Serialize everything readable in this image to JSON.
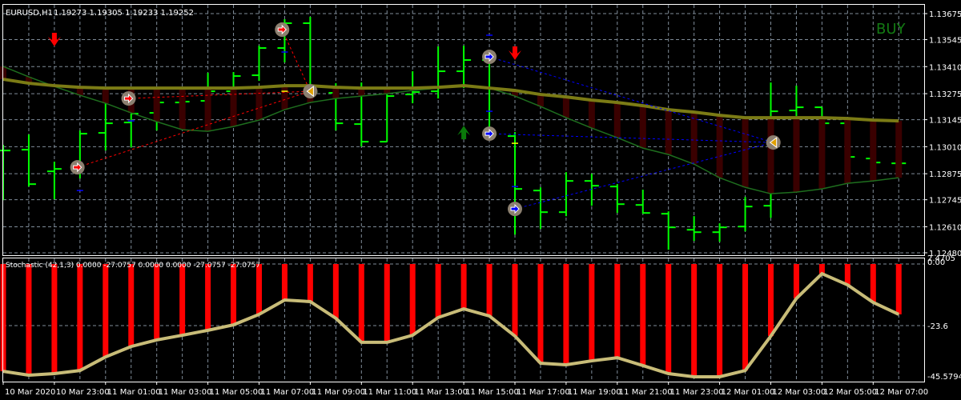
{
  "header": {
    "symbol": "EURUSD,H1",
    "ohlc": "1.19273 1.19305 1.19233 1.19252"
  },
  "signal_label": "BUY",
  "price_axis": [
    "1.13675",
    "1.13545",
    "1.13410",
    "1.13275",
    "1.13145",
    "1.13010",
    "1.12875",
    "1.12745",
    "1.12610",
    "1.12480"
  ],
  "price_axis_values": [
    1.13675,
    1.13545,
    1.1341,
    1.13275,
    1.13145,
    1.1301,
    1.12875,
    1.12745,
    1.1261,
    1.1248
  ],
  "stochastic": {
    "label": "Stochastic (42,1,3) 0.0000 -27.0757 0.0000 0.0000 -27.0757 -27.0757",
    "axis": [
      "2.4705",
      "0.00",
      "-23.6",
      "-45.5794"
    ],
    "values": [
      -41.1,
      -42.6,
      -42.0,
      -40.8,
      -35.6,
      -31.6,
      -29.1,
      -27.3,
      -25.4,
      -23.3,
      -19.3,
      -13.8,
      -14.4,
      -20.8,
      -30.0,
      -30.0,
      -27.3,
      -20.5,
      -17.2,
      -19.9,
      -27.6,
      -38.0,
      -38.6,
      -37.1,
      -35.9,
      -38.9,
      -42.0,
      -43.2,
      -43.2,
      -40.8,
      -27.6,
      -13.2,
      -3.7,
      -8.0,
      -14.7,
      -19.3
    ]
  },
  "time_axis": [
    "10 Mar 2020",
    "10 Mar 23:00",
    "11 Mar 01:00",
    "11 Mar 03:00",
    "11 Mar 05:00",
    "11 Mar 07:00",
    "11 Mar 09:00",
    "11 Mar 11:00",
    "11 Mar 13:00",
    "11 Mar 15:00",
    "11 Mar 17:00",
    "11 Mar 19:00",
    "11 Mar 21:00",
    "11 Mar 23:00",
    "12 Mar 01:00",
    "12 Mar 03:00",
    "12 Mar 05:00",
    "12 Mar 07:00"
  ],
  "colors": {
    "bars": "#00ff00",
    "ma": "#7b7b15",
    "lower": "#1e6e1e",
    "histogram": "#3a0000",
    "stoch_bars": "#ff0000",
    "stoch_line": "#c8bc78",
    "grid": "#7f8c99",
    "buy": "#137a13"
  },
  "chart_data": {
    "type": "ohlc",
    "ohlc": [
      [
        1.12991,
        1.13019,
        1.12743,
        1.12991
      ],
      [
        1.12995,
        1.13071,
        1.12811,
        1.12823
      ],
      [
        1.12887,
        1.12935,
        1.12747,
        1.12899
      ],
      [
        1.12903,
        1.13091,
        1.12851,
        1.13075
      ],
      [
        1.13079,
        1.13227,
        1.12991,
        1.13127
      ],
      [
        1.13131,
        1.13175,
        1.13007,
        1.13175
      ],
      [
        1.13179,
        1.13231,
        1.13091,
        1.13231
      ],
      [
        1.13231,
        1.13239,
        1.13223,
        1.13235
      ],
      [
        1.13239,
        1.13379,
        1.13235,
        1.13287
      ],
      [
        1.13287,
        1.13383,
        1.13279,
        1.13363
      ],
      [
        1.13367,
        1.13515,
        1.13339,
        1.13503
      ],
      [
        1.13503,
        1.13647,
        1.13431,
        1.13627
      ],
      [
        1.13627,
        1.13659,
        1.13263,
        1.13283
      ],
      [
        1.13279,
        1.13327,
        1.13091,
        1.13127
      ],
      [
        1.13123,
        1.13331,
        1.13011,
        1.13035
      ],
      [
        1.13035,
        1.13271,
        1.13035,
        1.13263
      ],
      [
        1.13271,
        1.13387,
        1.13227,
        1.13283
      ],
      [
        1.13287,
        1.13511,
        1.13251,
        1.13387
      ],
      [
        1.13387,
        1.13515,
        1.13303,
        1.13443
      ],
      [
        1.13443,
        1.13483,
        1.13071,
        1.13071
      ],
      [
        1.13063,
        1.13083,
        1.12571,
        1.12799
      ],
      [
        1.12791,
        1.12807,
        1.12599,
        1.12683
      ],
      [
        1.12683,
        1.12883,
        1.12663,
        1.12839
      ],
      [
        1.12839,
        1.12875,
        1.12715,
        1.12815
      ],
      [
        1.12811,
        1.12823,
        1.12679,
        1.12723
      ],
      [
        1.12719,
        1.12795,
        1.12675,
        1.12679
      ],
      [
        1.12675,
        1.12687,
        1.12495,
        1.12607
      ],
      [
        1.12595,
        1.12663,
        1.12539,
        1.12583
      ],
      [
        1.12583,
        1.12627,
        1.12535,
        1.12607
      ],
      [
        1.12611,
        1.12759,
        1.12587,
        1.12711
      ],
      [
        1.12715,
        1.13331,
        1.12655,
        1.13187
      ],
      [
        1.13191,
        1.13315,
        1.13163,
        1.13207
      ],
      [
        1.13207,
        1.13207,
        1.13127,
        1.13127
      ],
      [
        1.13127,
        1.13143,
        1.12955,
        1.12959
      ],
      [
        1.12951,
        1.12959,
        1.12923,
        1.12931
      ],
      [
        1.12927,
        1.12943,
        1.12919,
        1.12927
      ]
    ],
    "ma": [
      1.13347,
      1.13327,
      1.13315,
      1.13307,
      1.13303,
      1.13303,
      1.13303,
      1.13303,
      1.13303,
      1.13303,
      1.13307,
      1.13315,
      1.13315,
      1.13307,
      1.13303,
      1.13303,
      1.13303,
      1.13307,
      1.13315,
      1.13303,
      1.13291,
      1.13271,
      1.13259,
      1.13243,
      1.13231,
      1.13215,
      1.13195,
      1.13183,
      1.13167,
      1.13155,
      1.13155,
      1.13155,
      1.13155,
      1.13151,
      1.13143,
      1.13139
    ],
    "lower": [
      1.13411,
      1.13359,
      1.13311,
      1.13267,
      1.13227,
      1.13179,
      1.13135,
      1.13095,
      1.13087,
      1.13111,
      1.13143,
      1.13195,
      1.13231,
      1.13251,
      1.13263,
      1.13275,
      1.13291,
      1.13303,
      1.13315,
      1.13303,
      1.13263,
      1.13211,
      1.13155,
      1.13103,
      1.13055,
      1.13003,
      1.12971,
      1.12923,
      1.12855,
      1.12807,
      1.12775,
      1.12783,
      1.12799,
      1.12827,
      1.12839,
      1.12855
    ],
    "signals": [
      {
        "bar": 2.9,
        "price": 1.12907,
        "dir": "right",
        "color": "#ff0000"
      },
      {
        "bar": 4.9,
        "price": 1.13251,
        "dir": "right",
        "color": "#ff0000"
      },
      {
        "bar": 10.9,
        "price": 1.13595,
        "dir": "right",
        "color": "#ff0000"
      },
      {
        "bar": 12,
        "price": 1.13287,
        "dir": "left",
        "color": "#e0a000"
      },
      {
        "bar": 19,
        "price": 1.13459,
        "dir": "right",
        "color": "#0000ff"
      },
      {
        "bar": 19,
        "price": 1.13075,
        "dir": "right",
        "color": "#0000ff"
      },
      {
        "bar": 20,
        "price": 1.12699,
        "dir": "right",
        "color": "#0000ff"
      },
      {
        "bar": 30.1,
        "price": 1.13031,
        "dir": "left",
        "color": "#e0a000"
      }
    ],
    "links": [
      [
        0,
        3,
        "#ff0000"
      ],
      [
        1,
        3,
        "#ff0000"
      ],
      [
        2,
        3,
        "#ff0000"
      ],
      [
        4,
        7,
        "#0000ff"
      ],
      [
        5,
        7,
        "#0000ff"
      ],
      [
        6,
        7,
        "#0000ff"
      ]
    ],
    "arrows": [
      {
        "bar": 2,
        "price": 1.13543,
        "dir": "down",
        "color": "#ff0000"
      },
      {
        "bar": 20,
        "price": 1.13475,
        "dir": "down",
        "color": "#ff0000"
      },
      {
        "bar": 18,
        "price": 1.13083,
        "dir": "up",
        "color": "#0a7a0a"
      }
    ],
    "dashes": [
      {
        "bar": 3,
        "price": 1.12791,
        "color": "#0000ff"
      },
      {
        "bar": 11,
        "price": 1.13483,
        "color": "#0000ff"
      },
      {
        "bar": 5,
        "price": 1.13139,
        "color": "#0000ff"
      },
      {
        "bar": 19,
        "price": 1.13567,
        "color": "#0000ff"
      },
      {
        "bar": 19,
        "price": 1.13187,
        "color": "#0000ff"
      },
      {
        "bar": 20,
        "price": 1.12811,
        "color": "#0000ff"
      },
      {
        "bar": 11,
        "price": 1.13287,
        "color": "#ffff00"
      },
      {
        "bar": 20,
        "price": 1.13027,
        "color": "#ffff00"
      }
    ]
  }
}
